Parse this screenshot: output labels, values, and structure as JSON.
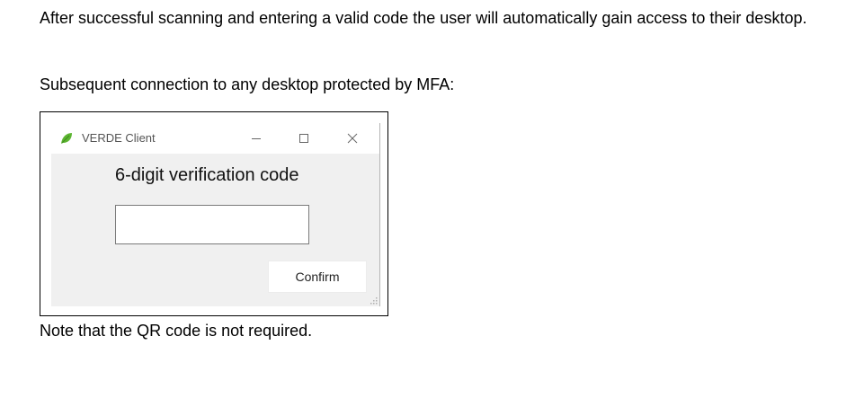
{
  "document": {
    "para1": "After successful scanning and entering a valid code the user will automatically gain access to their desktop.",
    "para2": "Subsequent connection to any desktop protected by MFA:",
    "para3": "Note that the QR code is not required."
  },
  "dialog": {
    "title": "VERDE Client",
    "app_icon": "green-leaf-icon",
    "heading": "6-digit verification code",
    "code_input": {
      "value": "",
      "placeholder": ""
    },
    "confirm_label": "Confirm",
    "controls": [
      "minimize-icon",
      "maximize-icon",
      "close-icon"
    ]
  },
  "colors": {
    "client_background": "#f0f0f0",
    "leaf_green": "#5cb531"
  }
}
